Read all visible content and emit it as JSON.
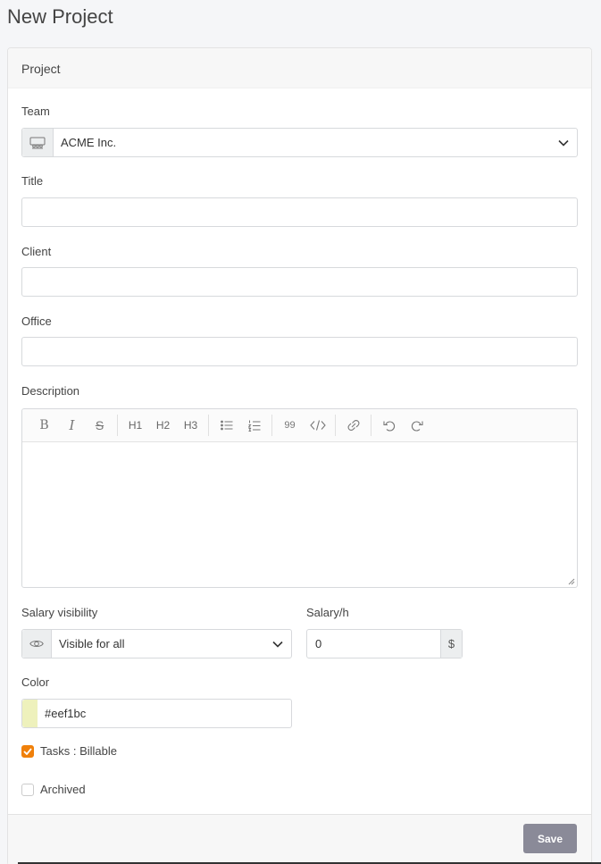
{
  "page": {
    "title": "New Project"
  },
  "card": {
    "header": "Project"
  },
  "form": {
    "team": {
      "label": "Team",
      "value": "ACME Inc."
    },
    "title": {
      "label": "Title",
      "value": ""
    },
    "client": {
      "label": "Client",
      "value": ""
    },
    "office": {
      "label": "Office",
      "value": ""
    },
    "description": {
      "label": "Description",
      "toolbar": {
        "bold": "B",
        "italic": "I",
        "strike": "S",
        "h1": "H1",
        "h2": "H2",
        "h3": "H3",
        "quote": "99"
      }
    },
    "salary_visibility": {
      "label": "Salary visibility",
      "value": "Visible for all"
    },
    "salary_rate": {
      "label": "Salary/h",
      "value": "0",
      "currency": "$"
    },
    "color": {
      "label": "Color",
      "value": "#eef1bc",
      "swatch": "#eef1bc"
    },
    "tasks_billable": {
      "label": "Tasks : Billable",
      "checked": true
    },
    "archived": {
      "label": "Archived",
      "checked": false
    }
  },
  "footer": {
    "save_label": "Save"
  },
  "colors": {
    "accent_checkbox": "#f0800a",
    "save_button": "#8a8a98"
  }
}
